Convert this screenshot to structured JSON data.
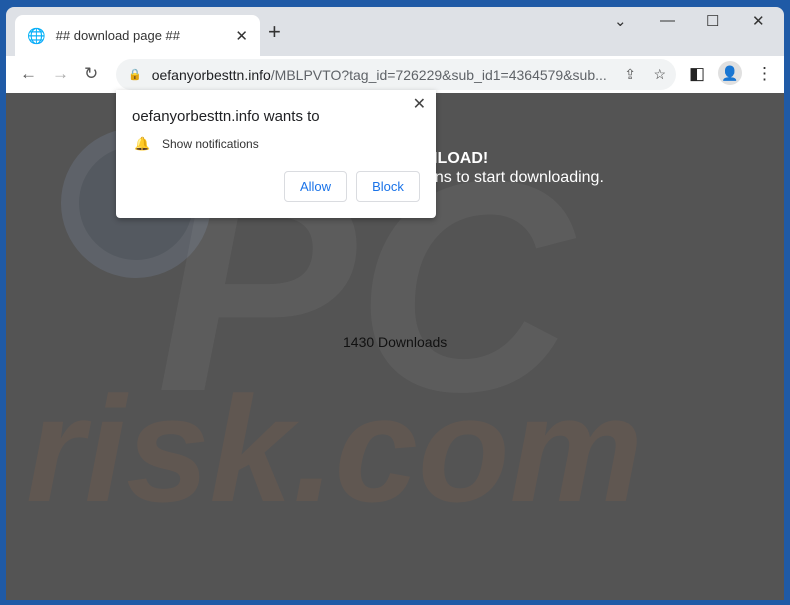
{
  "tab": {
    "title": "## download page ##",
    "favicon": "globe-icon"
  },
  "url": {
    "host": "oefanyorbesttn.info",
    "path": "/MBLPVTO?tag_id=726229&sub_id1=4364579&sub..."
  },
  "page": {
    "heading_fragment": "NLOAD!",
    "subtext_fragment": "ons to start downloading.",
    "downloads": "1430 Downloads",
    "watermark": "PC risk.com"
  },
  "popup": {
    "title": "oefanyorbesttn.info wants to",
    "permission": "Show notifications",
    "allow": "Allow",
    "block": "Block"
  },
  "colors": {
    "frame": "#1f5aa6",
    "page_bg": "#545454",
    "button_text": "#1a73e8"
  }
}
